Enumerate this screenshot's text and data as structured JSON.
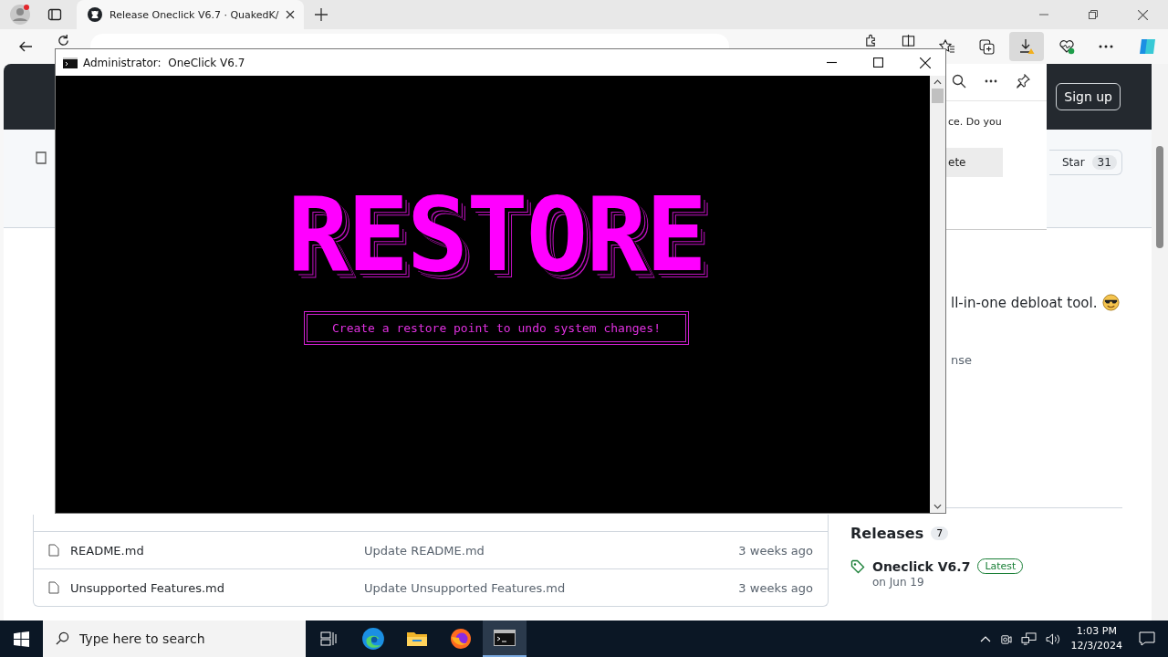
{
  "browser": {
    "tabs": [
      {
        "title": "Release Oneclick V6.7 · QuakedK/",
        "selected": true
      }
    ]
  },
  "github": {
    "sign_up": "Sign up",
    "star": {
      "label": "Star",
      "count": "31"
    },
    "downloads_panel": {
      "message": "ce. Do you",
      "button": "ete"
    },
    "about": {
      "description": "ll-in-one debloat tool.",
      "license": "nse"
    },
    "files": [
      {
        "name": "README.md",
        "commit": "Update README.md",
        "time": "3 weeks ago"
      },
      {
        "name": "Unsupported Features.md",
        "commit": "Update Unsupported Features.md",
        "time": "3 weeks ago"
      }
    ],
    "releases": {
      "title": "Releases",
      "count": "7",
      "latest": {
        "name": "Oneclick V6.7",
        "badge": "Latest",
        "date": "on Jun 19"
      }
    }
  },
  "console": {
    "title": "Administrator:  OneClick V6.7",
    "banner": "RESTORE",
    "message": "Create a restore point to undo system changes!"
  },
  "taskbar": {
    "search_placeholder": "Type here to search",
    "apps": [
      {
        "kind": "edge",
        "selected": false
      },
      {
        "kind": "explorer",
        "selected": false
      },
      {
        "kind": "firefox",
        "selected": false
      },
      {
        "kind": "terminal",
        "selected": true
      }
    ],
    "time": "1:03 PM",
    "date": "12/3/2024"
  }
}
